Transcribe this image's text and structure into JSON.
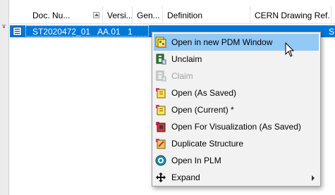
{
  "table": {
    "columns": [
      {
        "label": "Doc. Nu..."
      },
      {
        "label": "Versi..."
      },
      {
        "label": "Gen..."
      },
      {
        "label": "Definition"
      },
      {
        "label": "CERN Drawing Ref."
      },
      {
        "label": "S"
      }
    ],
    "selected_row": {
      "doc_number": "ST2020472_01",
      "version": "AA.01",
      "generation": "1",
      "definition": "",
      "cern_drawing_ref": "",
      "extra": "S"
    }
  },
  "context_menu": {
    "items": [
      {
        "label": "Open in new PDM Window",
        "icon": "pdm-window-icon",
        "enabled": true,
        "hovered": true
      },
      {
        "label": "Unclaim",
        "icon": "unclaim-icon",
        "enabled": true
      },
      {
        "label": "Claim",
        "icon": "claim-icon",
        "enabled": false
      },
      {
        "label": "Open (As Saved)",
        "icon": "open-as-saved-icon",
        "enabled": true
      },
      {
        "label": "Open (Current) *",
        "icon": "open-current-icon",
        "enabled": true
      },
      {
        "label": "Open For Visualization (As Saved)",
        "icon": "open-visualization-icon",
        "enabled": true
      },
      {
        "label": "Duplicate Structure",
        "icon": "duplicate-structure-icon",
        "enabled": true
      },
      {
        "label": "Open In PLM",
        "icon": "plm-icon",
        "enabled": true
      },
      {
        "label": "Expand",
        "icon": "expand-icon",
        "enabled": true,
        "has_submenu": true
      }
    ]
  },
  "colors": {
    "selection": "#0078d7",
    "menu_hover": "#91c9f7",
    "menu_background": "#f2f2f2",
    "disabled_text": "#a0a0a0"
  }
}
